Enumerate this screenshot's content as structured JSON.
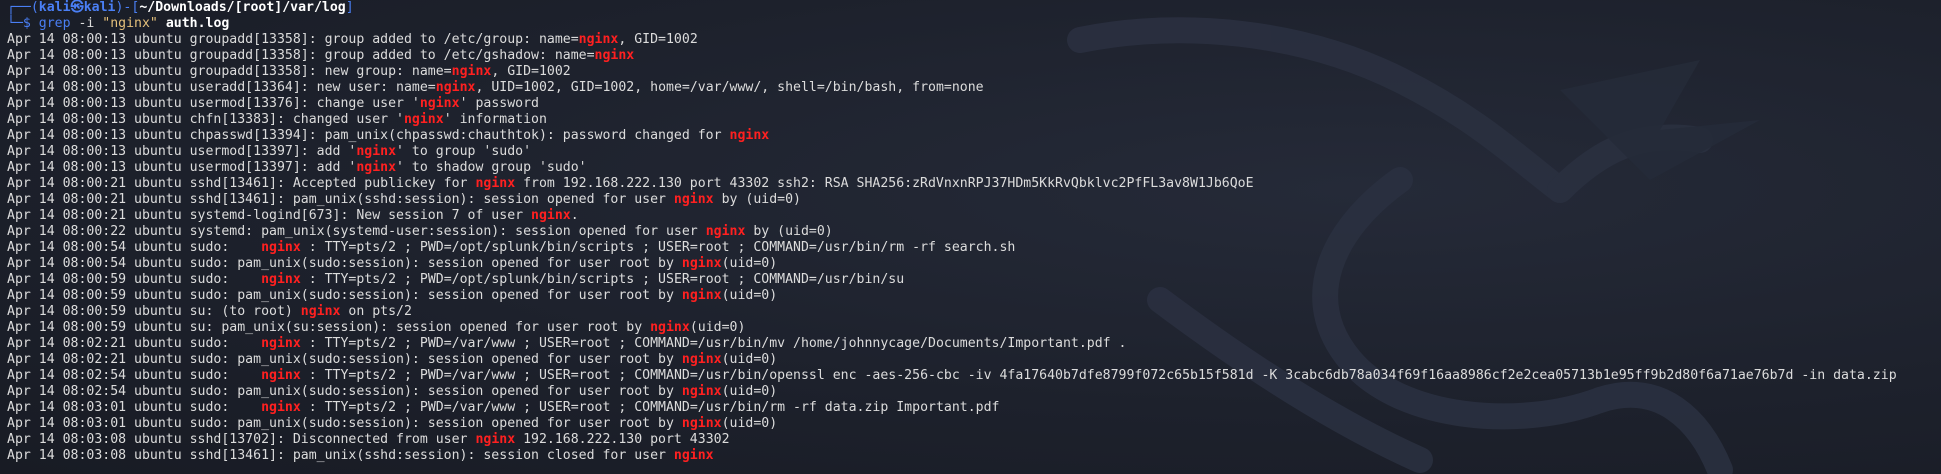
{
  "prompt": {
    "prefix": "┌──(",
    "user_host": "kali㉿kali",
    "mid": ")-[",
    "path": "~/Downloads/[root]/var/log",
    "suffix": "]",
    "line2_prefix": "└─$ ",
    "command": "grep",
    "flag": " -i ",
    "pattern": "\"nginx\"",
    "file": " auth.log"
  },
  "colors": {
    "background": "#1b1f2a",
    "text": "#dcdcdc",
    "prompt_blue": "#4a7ff5",
    "match_red": "#ff2020",
    "string_yellow": "#e5c07b"
  },
  "log_lines": [
    [
      "Apr 14 08:00:13 ubuntu groupadd[13358]: group added to /etc/group: name=",
      "nginx",
      ", GID=1002"
    ],
    [
      "Apr 14 08:00:13 ubuntu groupadd[13358]: group added to /etc/gshadow: name=",
      "nginx",
      ""
    ],
    [
      "Apr 14 08:00:13 ubuntu groupadd[13358]: new group: name=",
      "nginx",
      ", GID=1002"
    ],
    [
      "Apr 14 08:00:13 ubuntu useradd[13364]: new user: name=",
      "nginx",
      ", UID=1002, GID=1002, home=/var/www/, shell=/bin/bash, from=none"
    ],
    [
      "Apr 14 08:00:13 ubuntu usermod[13376]: change user '",
      "nginx",
      "' password"
    ],
    [
      "Apr 14 08:00:13 ubuntu chfn[13383]: changed user '",
      "nginx",
      "' information"
    ],
    [
      "Apr 14 08:00:13 ubuntu chpasswd[13394]: pam_unix(chpasswd:chauthtok): password changed for ",
      "nginx",
      ""
    ],
    [
      "Apr 14 08:00:13 ubuntu usermod[13397]: add '",
      "nginx",
      "' to group 'sudo'"
    ],
    [
      "Apr 14 08:00:13 ubuntu usermod[13397]: add '",
      "nginx",
      "' to shadow group 'sudo'"
    ],
    [
      "Apr 14 08:00:21 ubuntu sshd[13461]: Accepted publickey for ",
      "nginx",
      " from 192.168.222.130 port 43302 ssh2: RSA SHA256:zRdVnxnRPJ37HDm5KkRvQbklvc2PfFL3av8W1Jb6QoE"
    ],
    [
      "Apr 14 08:00:21 ubuntu sshd[13461]: pam_unix(sshd:session): session opened for user ",
      "nginx",
      " by (uid=0)"
    ],
    [
      "Apr 14 08:00:21 ubuntu systemd-logind[673]: New session 7 of user ",
      "nginx",
      "."
    ],
    [
      "Apr 14 08:00:22 ubuntu systemd: pam_unix(systemd-user:session): session opened for user ",
      "nginx",
      " by (uid=0)"
    ],
    [
      "Apr 14 08:00:54 ubuntu sudo:    ",
      "nginx",
      " : TTY=pts/2 ; PWD=/opt/splunk/bin/scripts ; USER=root ; COMMAND=/usr/bin/rm -rf search.sh"
    ],
    [
      "Apr 14 08:00:54 ubuntu sudo: pam_unix(sudo:session): session opened for user root by ",
      "nginx",
      "(uid=0)"
    ],
    [
      "Apr 14 08:00:59 ubuntu sudo:    ",
      "nginx",
      " : TTY=pts/2 ; PWD=/opt/splunk/bin/scripts ; USER=root ; COMMAND=/usr/bin/su"
    ],
    [
      "Apr 14 08:00:59 ubuntu sudo: pam_unix(sudo:session): session opened for user root by ",
      "nginx",
      "(uid=0)"
    ],
    [
      "Apr 14 08:00:59 ubuntu su: (to root) ",
      "nginx",
      " on pts/2"
    ],
    [
      "Apr 14 08:00:59 ubuntu su: pam_unix(su:session): session opened for user root by ",
      "nginx",
      "(uid=0)"
    ],
    [
      "Apr 14 08:02:21 ubuntu sudo:    ",
      "nginx",
      " : TTY=pts/2 ; PWD=/var/www ; USER=root ; COMMAND=/usr/bin/mv /home/johnnycage/Documents/Important.pdf ."
    ],
    [
      "Apr 14 08:02:21 ubuntu sudo: pam_unix(sudo:session): session opened for user root by ",
      "nginx",
      "(uid=0)"
    ],
    [
      "Apr 14 08:02:54 ubuntu sudo:    ",
      "nginx",
      " : TTY=pts/2 ; PWD=/var/www ; USER=root ; COMMAND=/usr/bin/openssl enc -aes-256-cbc -iv 4fa17640b7dfe8799f072c65b15f581d -K 3cabc6db78a034f69f16aa8986cf2e2cea05713b1e95ff9b2d80f6a71ae76b7d -in data.zip"
    ],
    [
      "Apr 14 08:02:54 ubuntu sudo: pam_unix(sudo:session): session opened for user root by ",
      "nginx",
      "(uid=0)"
    ],
    [
      "Apr 14 08:03:01 ubuntu sudo:    ",
      "nginx",
      " : TTY=pts/2 ; PWD=/var/www ; USER=root ; COMMAND=/usr/bin/rm -rf data.zip Important.pdf"
    ],
    [
      "Apr 14 08:03:01 ubuntu sudo: pam_unix(sudo:session): session opened for user root by ",
      "nginx",
      "(uid=0)"
    ],
    [
      "Apr 14 08:03:08 ubuntu sshd[13702]: Disconnected from user ",
      "nginx",
      " 192.168.222.130 port 43302"
    ],
    [
      "Apr 14 08:03:08 ubuntu sshd[13461]: pam_unix(sshd:session): session closed for user ",
      "nginx",
      ""
    ]
  ]
}
